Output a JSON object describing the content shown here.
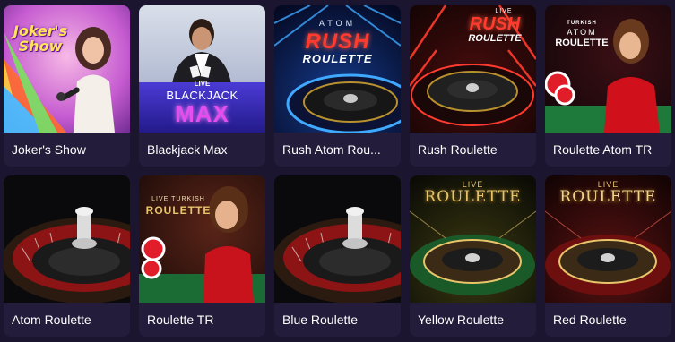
{
  "games": [
    {
      "title": "Joker's Show",
      "logo": "Joker's Show"
    },
    {
      "title": "Blackjack Max",
      "logo_top": "LIVE",
      "logo_main": "BLACKJACK",
      "logo_sub": "MAX"
    },
    {
      "title": "Rush Atom Rou...",
      "logo_top": "ATOM",
      "logo_main": "RUSH",
      "logo_sub": "ROULETTE"
    },
    {
      "title": "Rush Roulette",
      "logo_top": "LIVE",
      "logo_main": "RUSH",
      "logo_sub": "ROULETTE"
    },
    {
      "title": "Roulette Atom TR",
      "logo_top": "TURKISH",
      "logo_main": "ATOM",
      "logo_sub": "ROULETTE"
    },
    {
      "title": "Atom Roulette"
    },
    {
      "title": "Roulette TR",
      "logo_top": "LIVE TURKISH",
      "logo_main": "ROULETTE"
    },
    {
      "title": "Blue Roulette"
    },
    {
      "title": "Yellow Roulette",
      "logo_top": "LIVE",
      "logo_main": "ROULETTE"
    },
    {
      "title": "Red Roulette",
      "logo_top": "LIVE",
      "logo_main": "ROULETTE"
    }
  ],
  "colors": {
    "page_bg": "#1b1530",
    "caption_bg": "#241c3b",
    "text": "#ffffff",
    "rush_red": "#ff3b2f",
    "max_magenta": "#e64df0",
    "gold": "#e8c46a"
  }
}
